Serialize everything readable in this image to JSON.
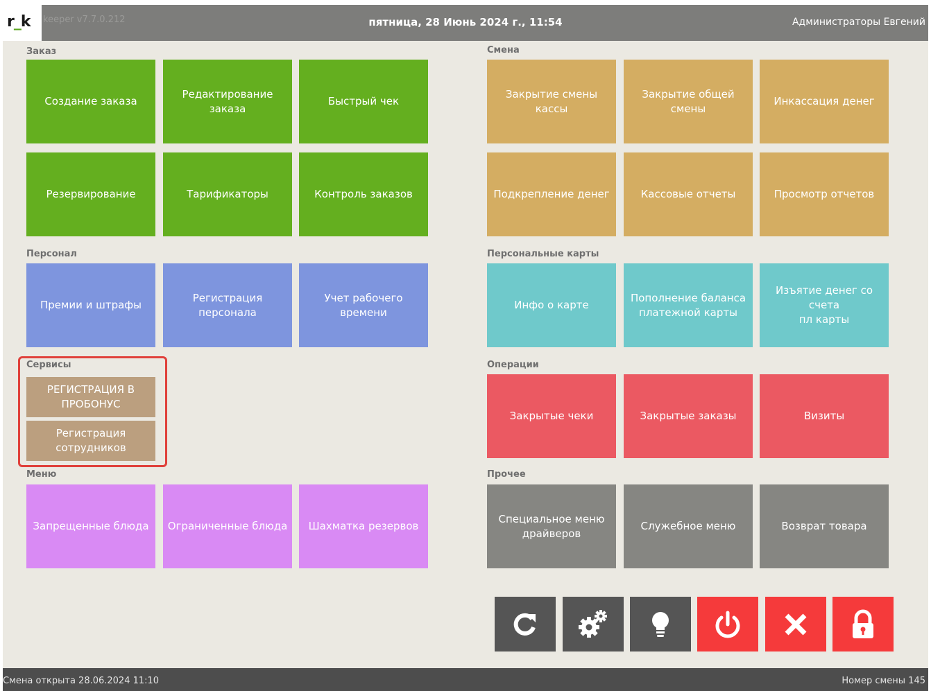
{
  "header": {
    "logo_prefix": "r",
    "logo_sep": "_",
    "logo_suffix": "k",
    "version": "keeper v7.7.0.212",
    "datetime": "пятница, 28 Июнь 2024 г., 11:54",
    "user": "Администраторы Евгений"
  },
  "sections": {
    "order": "Заказ",
    "shift": "Смена",
    "staff": "Персонал",
    "cards": "Персональные карты",
    "services": "Сервисы",
    "operations": "Операции",
    "menu": "Меню",
    "other": "Прочее"
  },
  "order_tiles": [
    "Создание заказа",
    "Редактирование заказа",
    "Быстрый чек",
    "Резервирование",
    "Тарификаторы",
    "Контроль заказов"
  ],
  "shift_tiles": [
    "Закрытие смены кассы",
    "Закрытие общей смены",
    "Инкассация денег",
    "Подкрепление денег",
    "Кассовые отчеты",
    "Просмотр отчетов"
  ],
  "staff_tiles": [
    "Премии и штрафы",
    "Регистрация персонала",
    "Учет рабочего времени"
  ],
  "card_tiles": [
    "Инфо о карте",
    "Пополнение баланса\nплатежной карты",
    "Изъятие денег со счета\nпл карты"
  ],
  "service_tiles": [
    "РЕГИСТРАЦИЯ В\nПРОБОНУС",
    "Регистрация\nсотрудников"
  ],
  "operation_tiles": [
    "Закрытые чеки",
    "Закрытые заказы",
    "Визиты"
  ],
  "menu_tiles": [
    "Запрещенные блюда",
    "Ограниченные блюда",
    "Шахматка резервов"
  ],
  "other_tiles": [
    "Специальное меню\nдрайверов",
    "Служебное меню",
    "Возврат товара"
  ],
  "toolbar_icons": [
    "refresh-icon",
    "gears-icon",
    "lightbulb-icon",
    "power-icon",
    "close-icon",
    "lock-icon"
  ],
  "status": {
    "left": "Смена открыта 28.06.2024 11:10",
    "right": "Номер смены 145"
  },
  "colors": {
    "order": "#64af1f",
    "shift": "#d4ad62",
    "staff": "#7e95de",
    "cards": "#6fc9cb",
    "services": "#bb9f7f",
    "operations": "#eb5962",
    "menu": "#d98af4",
    "other": "#868682",
    "highlight": "#e0413b",
    "danger": "#f53a3b"
  }
}
